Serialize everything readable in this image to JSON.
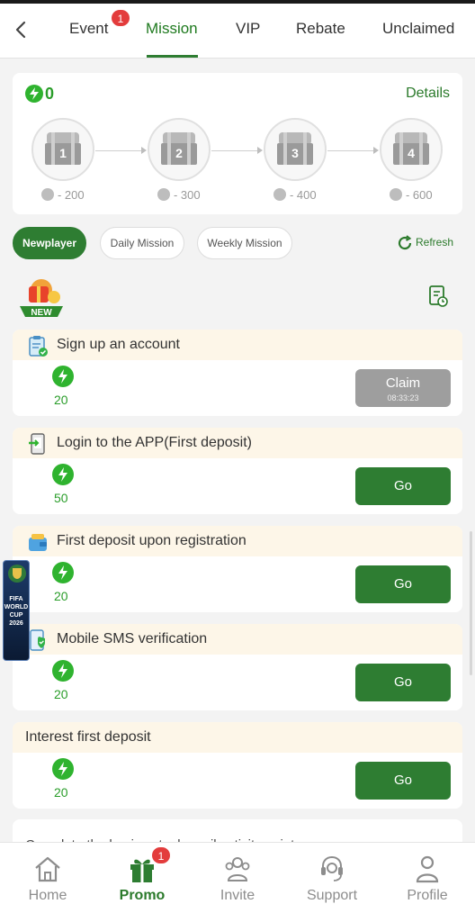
{
  "header": {
    "tabs": [
      {
        "label": "Event",
        "badge": "1"
      },
      {
        "label": "Mission",
        "active": true
      },
      {
        "label": "VIP"
      },
      {
        "label": "Rebate"
      },
      {
        "label": "Unclaimed"
      }
    ]
  },
  "treasure": {
    "points": "0",
    "details_label": "Details",
    "chests": [
      {
        "num": "1",
        "cost": "- 200"
      },
      {
        "num": "2",
        "cost": "- 300"
      },
      {
        "num": "3",
        "cost": "- 400"
      },
      {
        "num": "4",
        "cost": "- 600"
      }
    ]
  },
  "filters": {
    "chips": [
      "Newplayer",
      "Daily Mission",
      "Weekly Mission"
    ],
    "active_chip": "Newplayer",
    "refresh_label": "Refresh"
  },
  "new_badge_label": "NEW",
  "missions": [
    {
      "title": "Sign up an account",
      "reward": "20",
      "button": "Claim",
      "countdown": "08:33:23",
      "state": "claim"
    },
    {
      "title": "Login to the APP(First deposit)",
      "reward": "50",
      "button": "Go",
      "state": "go"
    },
    {
      "title": "First deposit upon registration",
      "reward": "20",
      "button": "Go",
      "state": "go"
    },
    {
      "title": "Mobile SMS verification",
      "reward": "20",
      "button": "Go",
      "state": "go"
    },
    {
      "title": "Interest first deposit",
      "reward": "20",
      "button": "Go",
      "state": "go"
    }
  ],
  "partial_mission_text": "Complete the basic actual email activity points",
  "floating_banner": {
    "line1": "FIFA",
    "line2": "WORLD CUP",
    "line3": "2026"
  },
  "bottom_nav": {
    "items": [
      {
        "label": "Home"
      },
      {
        "label": "Promo",
        "badge": "1",
        "active": true
      },
      {
        "label": "Invite"
      },
      {
        "label": "Support"
      },
      {
        "label": "Profile"
      }
    ]
  },
  "colors": {
    "accent": "#2e7d32",
    "badge": "#e33c3c",
    "reward": "#2a9d2a",
    "card_head": "#fdf6e8"
  }
}
